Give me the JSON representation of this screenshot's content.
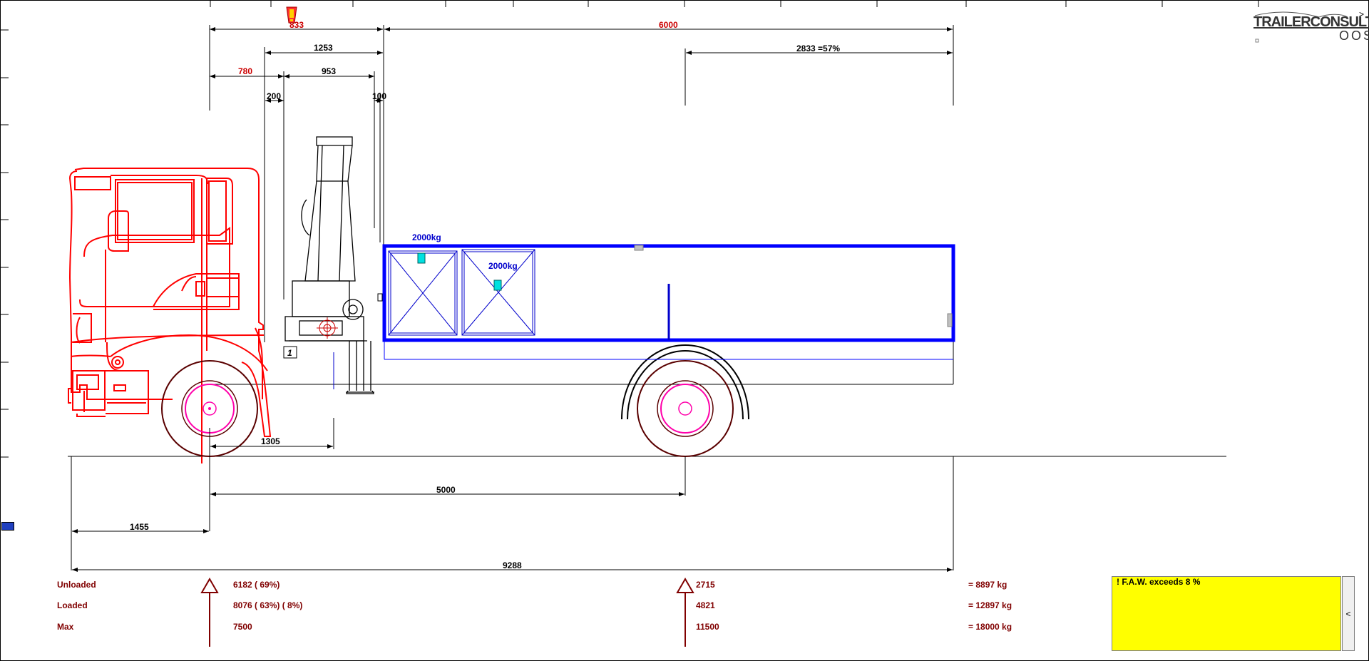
{
  "app": {
    "logo_text": "TRAILERCONSULT",
    "logo_sub": "OOS"
  },
  "dimensions": {
    "top": {
      "d833": "833",
      "d6000": "6000",
      "d1253": "1253",
      "d2833": "2833 =57%",
      "d780": "780",
      "d953": "953",
      "d200": "200",
      "d100": "100"
    },
    "bottom": {
      "d1305": "1305",
      "d5000": "5000",
      "d1455": "1455",
      "d9288": "9288"
    }
  },
  "loads": {
    "load1": "2000kg",
    "load2": "2000kg"
  },
  "marker": "1",
  "weights": {
    "rows": [
      {
        "label": "Unloaded",
        "front": "6182 ( 69%)",
        "rear": "2715",
        "total": "= 8897 kg"
      },
      {
        "label": "Loaded",
        "front": "8076 ( 63%)  ( 8%)",
        "rear": "4821",
        "total": "= 12897 kg"
      },
      {
        "label": "Max",
        "front": "7500",
        "rear": "11500",
        "total": "= 18000 kg"
      }
    ]
  },
  "warning": {
    "text": "! F.A.W. exceeds  8 %"
  },
  "scroll_button": "<",
  "corner_arrow": ">",
  "colors": {
    "cab": "#ff0000",
    "body": "#0000ff",
    "wheel_hub": "#ff00aa",
    "tire": "#5a0000",
    "dim_black": "#000000",
    "dim_red": "#cc0000",
    "dim_blue": "#0000cc",
    "warning_bg": "#ffff00"
  }
}
